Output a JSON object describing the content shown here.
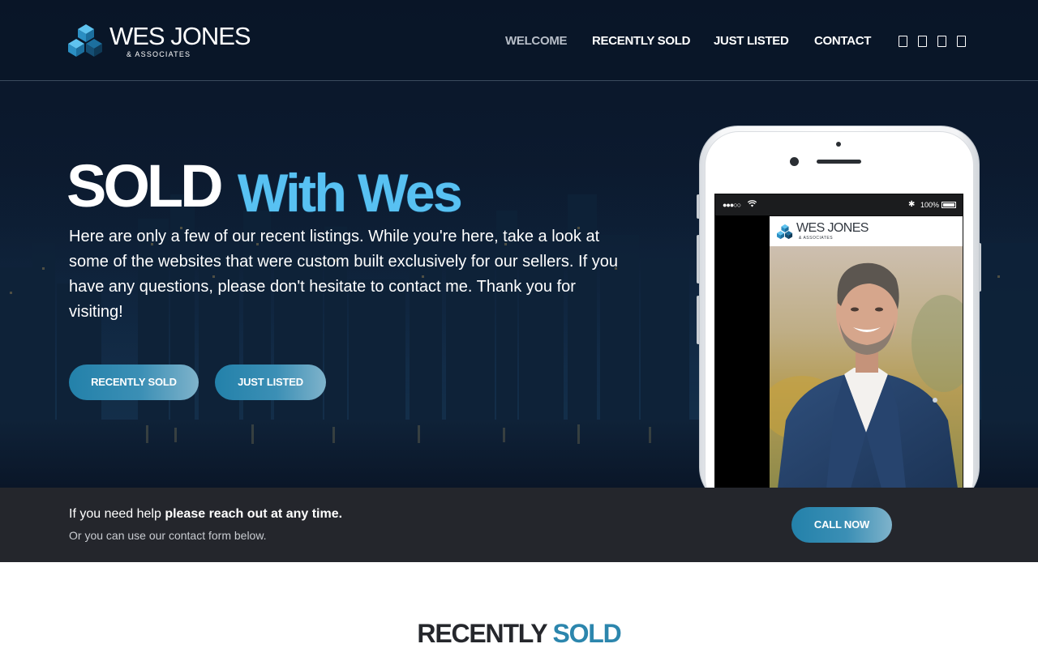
{
  "brand": {
    "name": "WES JONES",
    "tagline": "& ASSOCIATES",
    "logo_icon": "cube-stack-logo-icon",
    "colors": {
      "navy": "#0b1a2e",
      "accent_blue": "#58c1f2",
      "button_blue": "#2a86ae",
      "band": "#24262c"
    }
  },
  "nav": {
    "items": [
      {
        "label": "WELCOME",
        "active": true
      },
      {
        "label": "RECENTLY SOLD",
        "active": false
      },
      {
        "label": "JUST LISTED",
        "active": false
      },
      {
        "label": "CONTACT",
        "active": false
      }
    ],
    "social_icons": [
      "facebook-icon",
      "twitter-icon",
      "instagram-icon",
      "linkedin-icon"
    ]
  },
  "hero": {
    "headline_part1": "SOLD",
    "headline_part2": "With Wes",
    "intro": "Here are only a few of our recent listings. While you're here, take a look at some of the websites that were custom built exclusively for our sellers. If you have any questions, please don't hesitate to contact me. Thank you for visiting!",
    "buttons": [
      "RECENTLY SOLD",
      "JUST LISTED"
    ]
  },
  "phone": {
    "status_signal": "●●●○○",
    "status_bluetooth": "✱",
    "battery_text": "100%",
    "screen_brand_name": "WES JONES",
    "screen_brand_tagline": "& ASSOCIATES"
  },
  "cta_band": {
    "line1_lead": "If you need help ",
    "line1_bold": "please reach out at any time.",
    "line2": "Or you can use our contact form below.",
    "button": "CALL NOW"
  },
  "section": {
    "title_part1": "RECENTLY",
    "title_part2": "SOLD"
  }
}
